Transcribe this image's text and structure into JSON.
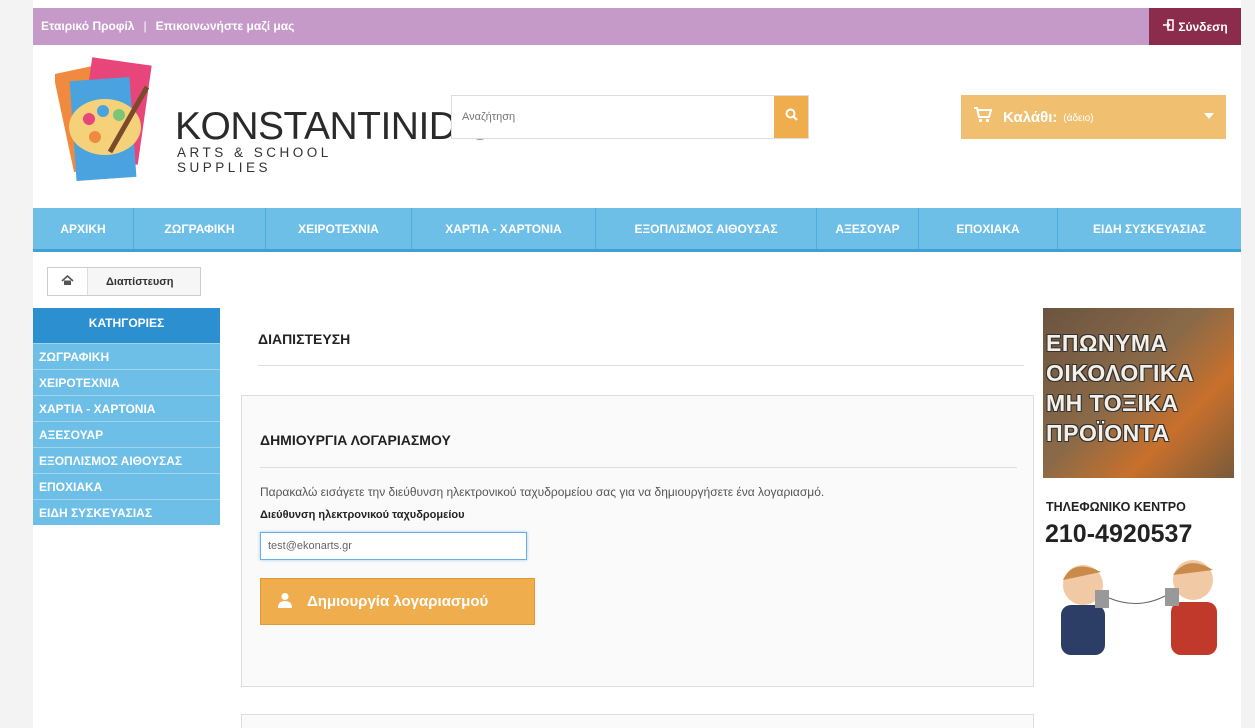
{
  "topbar": {
    "company_profile": "Εταιρικό Προφίλ",
    "separator": "|",
    "contact": "Επικοινωνήστε μαζί μας",
    "login": "Σύνδεση"
  },
  "logo": {
    "name": "KONSTANTINIDIS",
    "tagline": "ARTS & SCHOOL SUPPLIES"
  },
  "search": {
    "placeholder": "Αναζήτηση"
  },
  "cart": {
    "label": "Καλάθι:",
    "status": "(άδειο)"
  },
  "nav": {
    "items": [
      "ΑΡΧΙΚΗ",
      "ΖΩΓΡΑΦΙΚΗ",
      "ΧΕΙΡΟΤΕΧΝΙΑ",
      "ΧΑΡΤΙΑ - ΧΑΡΤΟΝΙΑ",
      "ΕΞΟΠΛΙΣΜΟΣ ΑΙΘΟΥΣΑΣ",
      "ΑΞΕΣΟΥΑΡ",
      "ΕΠΟΧΙΑΚΑ",
      "ΕΙΔΗ ΣΥΣΚΕΥΑΣΙΑΣ"
    ]
  },
  "breadcrumb": {
    "current": "Διαπίστευση"
  },
  "sidebar": {
    "title": "ΚΑΤΗΓΟΡΙΕΣ",
    "items": [
      "ΖΩΓΡΑΦΙΚΗ",
      "ΧΕΙΡΟΤΕΧΝΙΑ",
      "ΧΑΡΤΙΑ - ΧΑΡΤΟΝΙΑ",
      "ΑΞΕΣΟΥΑΡ",
      "ΕΞΟΠΛΙΣΜΟΣ ΑΙΘΟΥΣΑΣ",
      "ΕΠΟΧΙΑΚΑ",
      "ΕΙΔΗ ΣΥΣΚΕΥΑΣΙΑΣ"
    ]
  },
  "main": {
    "title": "ΔΙΑΠΙΣΤΕΥΣΗ",
    "create_account": {
      "heading": "ΔΗΜΙΟΥΡΓΙΑ ΛΟΓΑΡΙΑΣΜΟΥ",
      "intro": "Παρακαλώ εισάγετε την διεύθυνση ηλεκτρονικού ταχυδρομείου σας για να δημιουργήσετε ένα λογαριασμό.",
      "email_label": "Διεύθυνση ηλεκτρονικού ταχυδρομείου",
      "email_value": "test@ekonarts.gr",
      "button": "Δημιουργία λογαριασμού"
    }
  },
  "ads": {
    "eco_lines": [
      "ΕΠΩΝΥΜΑ",
      "ΟΙΚΟΛΟΓΙΚΑ",
      "ΜΗ ΤΟΞΙΚΑ",
      "ΠΡΟΪΟΝΤΑ"
    ],
    "phone_label": "ΤΗΛΕΦΩΝΙΚΟ ΚΕΝΤΡΟ",
    "phone_number": "210-4920537"
  },
  "colors": {
    "topbar": "#c59ac9",
    "login": "#8b2c4d",
    "nav": "#6dbfe8",
    "sidebar_head": "#2c8fd0",
    "accent_orange": "#f0ad4e"
  }
}
